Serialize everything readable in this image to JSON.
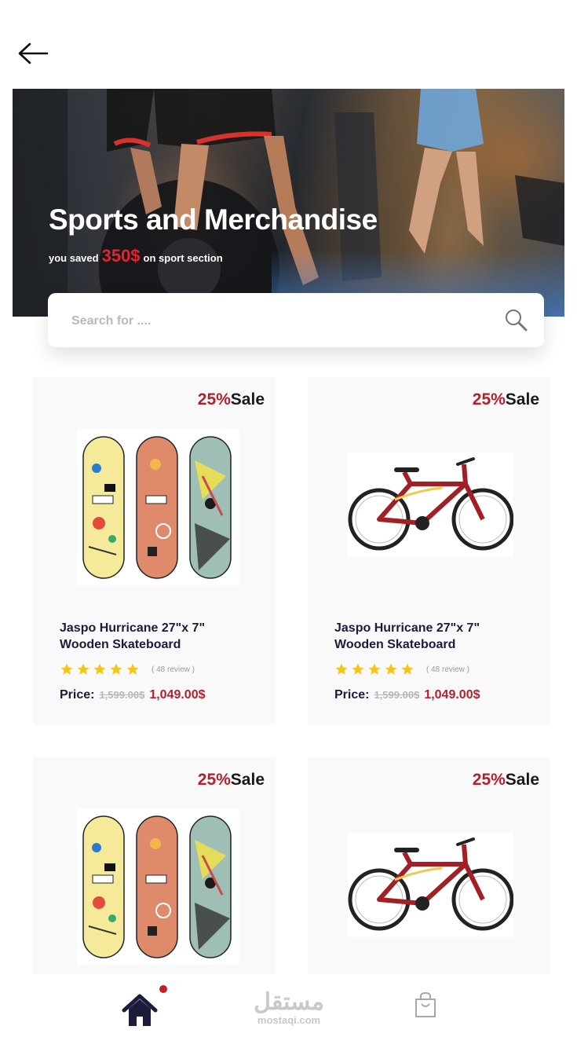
{
  "header": {
    "back_icon": "arrow-left-icon"
  },
  "hero": {
    "title": "Sports and Merchandise",
    "subtitle_prefix": "you saved",
    "saved_amount": "350$",
    "subtitle_suffix": "on sport section"
  },
  "search": {
    "placeholder": "Search for ....",
    "icon": "search-icon"
  },
  "products": [
    {
      "sale_percent": "25%",
      "sale_label": "Sale",
      "image": "skateboard-image",
      "name": "Jaspo Hurricane 27\"x 7\" Wooden Skateboard",
      "rating": 5,
      "review": "( 48 review )",
      "price_label": "Price:",
      "old_price": "1,599.00$",
      "new_price": "1,049.00$"
    },
    {
      "sale_percent": "25%",
      "sale_label": "Sale",
      "image": "bicycle-image",
      "name": "Jaspo Hurricane 27\"x 7\" Wooden Skateboard",
      "rating": 5,
      "review": "( 48 review )",
      "price_label": "Price:",
      "old_price": "1,599.00$",
      "new_price": "1,049.00$"
    },
    {
      "sale_percent": "25%",
      "sale_label": "Sale",
      "image": "skateboard-image"
    },
    {
      "sale_percent": "25%",
      "sale_label": "Sale",
      "image": "bicycle-image"
    }
  ],
  "bottom_nav": {
    "items": [
      {
        "icon": "home-icon",
        "active": true,
        "notification": true
      },
      {
        "icon": "shopping-bag-icon",
        "active": false
      }
    ],
    "watermark_ar": "مستقل",
    "watermark_en": "mostaqi.com"
  },
  "colors": {
    "accent": "#b0222d",
    "hero_amount": "#e52330",
    "text_dark": "#1c1b3a",
    "card_bg": "#f9f9f9",
    "star": "#f5c518"
  }
}
